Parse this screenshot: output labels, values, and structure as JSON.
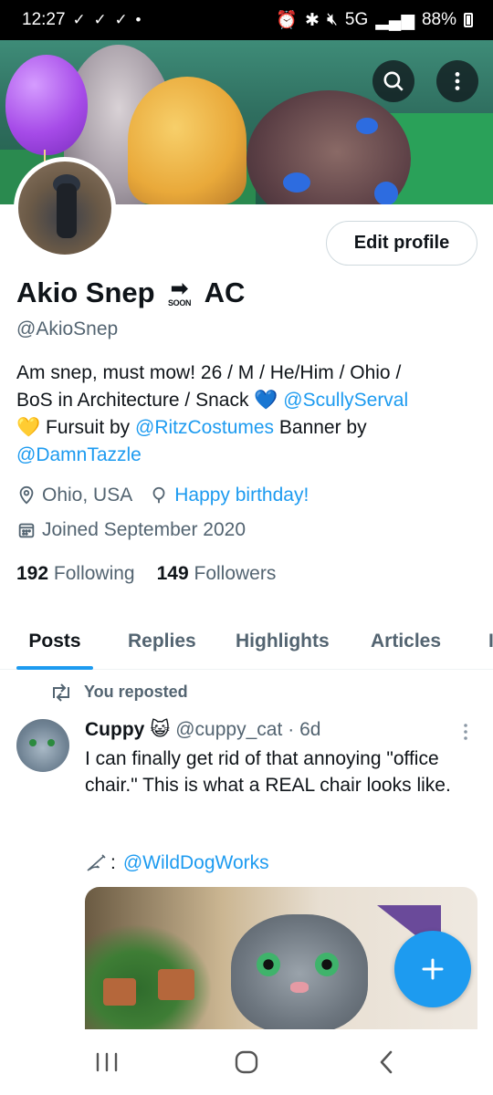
{
  "status_bar": {
    "time": "12:27",
    "notification_icons": "✓ ✓ ✓ •",
    "network": "5G",
    "battery": "88%"
  },
  "profile": {
    "display_name_start": "Akio Snep",
    "display_name_badge": "SOON",
    "display_name_end": "AC",
    "handle": "@AkioSnep",
    "edit_button": "Edit profile",
    "bio": {
      "line1": "Am snep, must mow!  26 / M / He/Him / Ohio /",
      "line2_text": "BoS in Architecture / Snack ",
      "line2_link": "@ScullyServal",
      "line3_prefix": " Fursuit by ",
      "line3_link": "@RitzCostumes",
      "line3_suffix": " Banner by",
      "line4_link": "@DamnTazzle"
    },
    "location": "Ohio, USA",
    "birthday": "Happy birthday!",
    "joined": "Joined September 2020",
    "following_count": "192",
    "following_label": "Following",
    "followers_count": "149",
    "followers_label": "Followers"
  },
  "tabs": [
    {
      "label": "Posts",
      "active": true
    },
    {
      "label": "Replies"
    },
    {
      "label": "Highlights"
    },
    {
      "label": "Articles"
    },
    {
      "label": "I"
    }
  ],
  "post": {
    "repost_label": "You reposted",
    "author_name": "Cuppy",
    "author_emoji": "😺",
    "author_handle": "@cuppy_cat",
    "time": "· 6d",
    "text": "I can finally get rid of that annoying \"office chair.\" This is what a REAL chair looks like.",
    "credit_link": "@WildDogWorks"
  },
  "colors": {
    "accent": "#1d9bf0",
    "text_primary": "#0f1419",
    "text_secondary": "#536471"
  }
}
